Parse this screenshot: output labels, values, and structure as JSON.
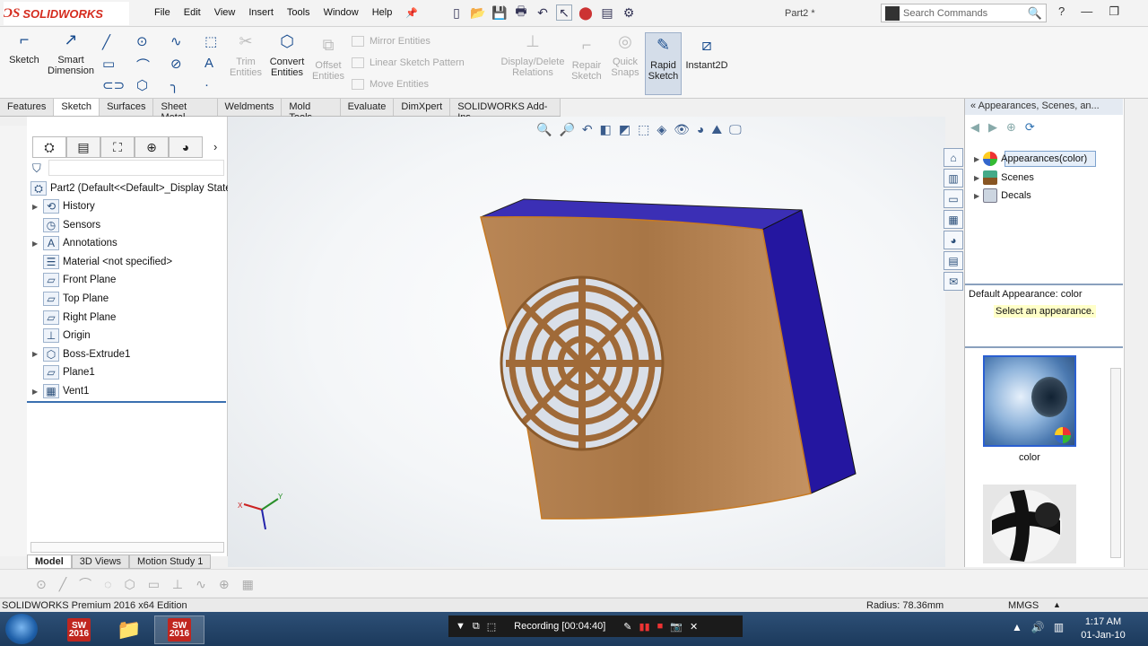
{
  "app": {
    "brand": "SOLIDWORKS",
    "doc_title": "Part2 *"
  },
  "menu": [
    "File",
    "Edit",
    "View",
    "Insert",
    "Tools",
    "Window",
    "Help"
  ],
  "search": {
    "placeholder": "Search Commands"
  },
  "command_manager": {
    "sketch": "Sketch",
    "smart_dimension": "Smart Dimension",
    "trim_entities": "Trim Entities",
    "convert_entities": "Convert Entities",
    "offset_entities": "Offset Entities",
    "mirror_entities": "Mirror Entities",
    "linear_sketch_pattern": "Linear Sketch Pattern",
    "move_entities": "Move Entities",
    "display_delete_relations": "Display/Delete Relations",
    "repair_sketch": "Repair Sketch",
    "quick_snaps": "Quick Snaps",
    "rapid_sketch": "Rapid Sketch",
    "instant2d": "Instant2D"
  },
  "tabs": [
    "Features",
    "Sketch",
    "Surfaces",
    "Sheet Metal",
    "Weldments",
    "Mold Tools",
    "Evaluate",
    "DimXpert",
    "SOLIDWORKS Add-Ins"
  ],
  "active_tab": "Sketch",
  "feature_tree": {
    "root": "Part2  (Default<<Default>_Display State",
    "items": [
      {
        "label": "History",
        "expandable": true
      },
      {
        "label": "Sensors",
        "expandable": false
      },
      {
        "label": "Annotations",
        "expandable": true
      },
      {
        "label": "Material <not specified>",
        "expandable": false
      },
      {
        "label": "Front Plane",
        "expandable": false
      },
      {
        "label": "Top Plane",
        "expandable": false
      },
      {
        "label": "Right Plane",
        "expandable": false
      },
      {
        "label": "Origin",
        "expandable": false
      },
      {
        "label": "Boss-Extrude1",
        "expandable": true
      },
      {
        "label": "Plane1",
        "expandable": false
      },
      {
        "label": "Vent1",
        "expandable": true
      }
    ]
  },
  "task_pane": {
    "title": "Appearances, Scenes, an...",
    "items": [
      "Appearances(color)",
      "Scenes",
      "Decals"
    ],
    "default_appearance": "Default Appearance: color",
    "hint": "Select an appearance.",
    "thumb_label": "color"
  },
  "bottom_tabs": [
    "Model",
    "3D Views",
    "Motion Study 1"
  ],
  "status": {
    "edition": "SOLIDWORKS Premium 2016 x64 Edition",
    "radius": "Radius: 78.36mm",
    "units": "MMGS"
  },
  "taskbar": {
    "recording": "Recording [00:04:40]",
    "time": "1:17 AM",
    "date": "01-Jan-10",
    "sw_label": "SW\n2016"
  },
  "colors": {
    "part_face": "#b07c48",
    "part_side": "#2a1f9a",
    "selection": "#2a5fd1",
    "brand_red": "#d52b1e"
  }
}
